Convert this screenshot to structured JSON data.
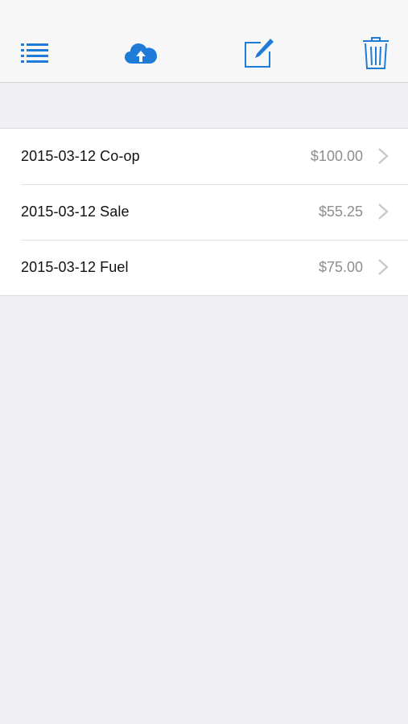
{
  "toolbar": {
    "buttons": [
      {
        "icon": "list-icon"
      },
      {
        "icon": "cloud-upload-icon"
      },
      {
        "icon": "compose-icon"
      },
      {
        "icon": "trash-icon"
      }
    ],
    "accent_color": "#1f7bd8"
  },
  "entries": [
    {
      "title": "2015-03-12 Co-op",
      "amount": "$100.00"
    },
    {
      "title": "2015-03-12 Sale",
      "amount": "$55.25"
    },
    {
      "title": "2015-03-12 Fuel",
      "amount": "$75.00"
    }
  ]
}
